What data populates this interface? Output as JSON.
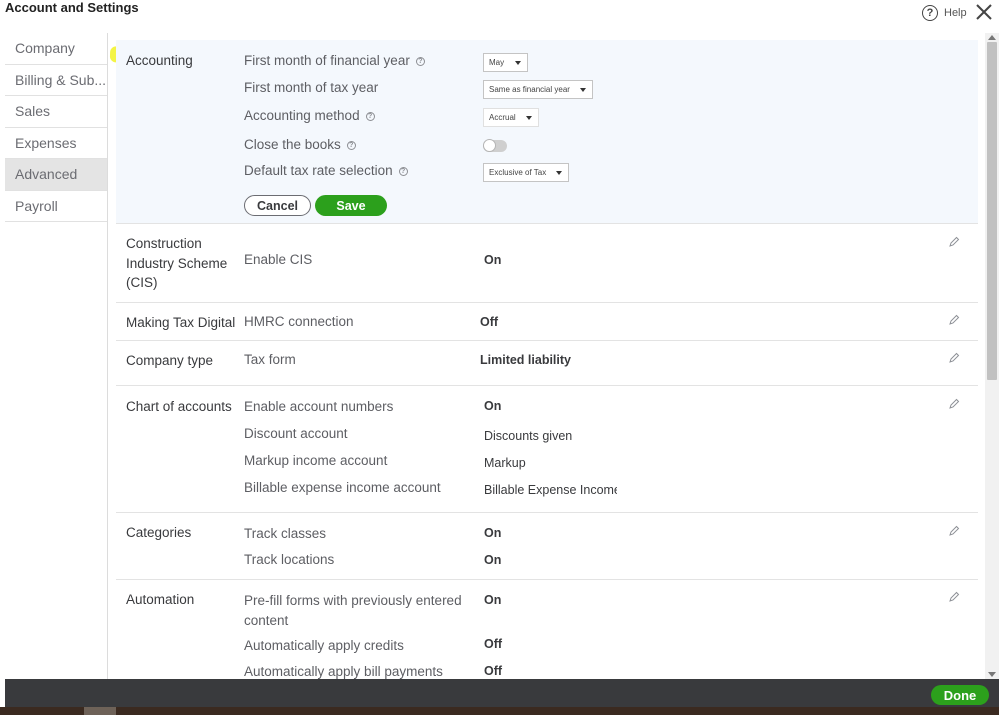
{
  "window": {
    "title": "Account and Settings",
    "help_label": "Help",
    "help_icon": "?",
    "close_icon": "close-icon"
  },
  "sidebar": {
    "items": [
      {
        "label": "Company",
        "active": false
      },
      {
        "label": "Billing & Sub...",
        "active": false
      },
      {
        "label": "Sales",
        "active": false
      },
      {
        "label": "Expenses",
        "active": false
      },
      {
        "label": "Advanced",
        "active": true
      },
      {
        "label": "Payroll",
        "active": false
      }
    ]
  },
  "accounting": {
    "title": "Accounting",
    "first_month_label": "First month of financial year",
    "first_month_value": "May",
    "first_tax_month_label": "First month of tax year",
    "first_tax_month_value": "Same as financial year",
    "accounting_method_label": "Accounting method",
    "accounting_method_value": "Accrual",
    "close_books_label": "Close the books",
    "close_books_on": false,
    "default_tax_label": "Default tax rate selection",
    "default_tax_value": "Exclusive of Tax",
    "cancel_label": "Cancel",
    "save_label": "Save",
    "help_glyph": "?"
  },
  "cis": {
    "title": "Construction Industry Scheme (CIS)",
    "label": "Enable CIS",
    "value": "On"
  },
  "mtd": {
    "title": "Making Tax Digital",
    "label": "HMRC connection",
    "value": "Off"
  },
  "company_type": {
    "title": "Company type",
    "label": "Tax form",
    "value": "Limited liability"
  },
  "chart_of_accounts": {
    "title": "Chart of accounts",
    "rows": [
      {
        "label": "Enable account numbers",
        "value": "On"
      },
      {
        "label": "Discount account",
        "value": "Discounts given"
      },
      {
        "label": "Markup income account",
        "value": "Markup"
      },
      {
        "label": "Billable expense income account",
        "value": "Billable Expense Income"
      }
    ]
  },
  "categories": {
    "title": "Categories",
    "rows": [
      {
        "label": "Track classes",
        "value": "On"
      },
      {
        "label": "Track locations",
        "value": "On"
      }
    ]
  },
  "automation": {
    "title": "Automation",
    "rows": [
      {
        "label": "Pre-fill forms with previously entered content",
        "value": "On"
      },
      {
        "label": "Automatically apply credits",
        "value": "Off"
      },
      {
        "label": "Automatically apply bill payments",
        "value": "Off"
      }
    ]
  },
  "footer": {
    "done_label": "Done"
  },
  "colors": {
    "accent_green": "#2ca01c",
    "highlight": "#f3f33b",
    "footer_bg": "#393a3d"
  }
}
